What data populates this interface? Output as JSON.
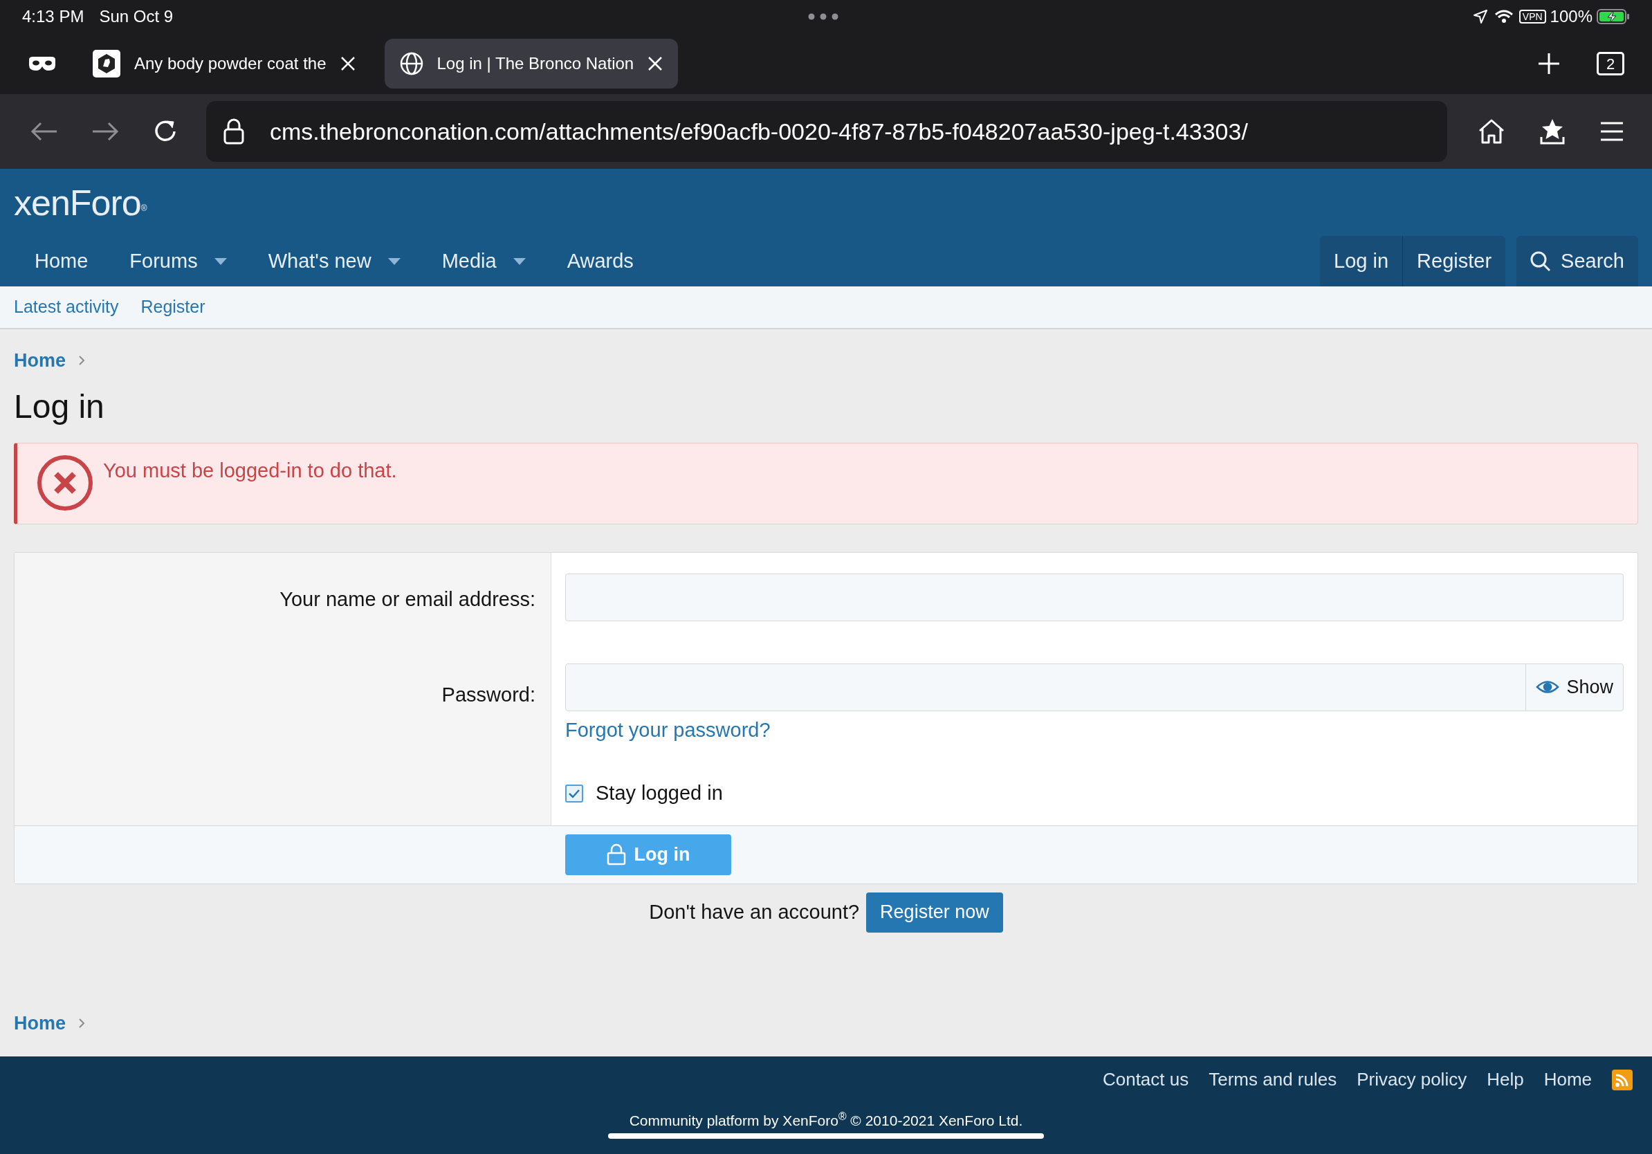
{
  "status_bar": {
    "time": "4:13 PM",
    "date": "Sun Oct 9",
    "vpn": "VPN",
    "battery": "100%"
  },
  "browser_tabs": [
    {
      "title": "Any body powder coat the",
      "kind": "favicon",
      "selected": false
    },
    {
      "title": "Log in | The Bronco Nation",
      "kind": "globe",
      "selected": true
    }
  ],
  "tab_count": "2",
  "address_bar": {
    "url": "cms.thebronconation.com/attachments/ef90acfb-0020-4f87-87b5-f048207aa530-jpeg-t.43303/"
  },
  "site": {
    "logo": "xenForo",
    "logo_mark": "®"
  },
  "nav": [
    {
      "label": "Home",
      "has_menu": false
    },
    {
      "label": "Forums",
      "has_menu": true
    },
    {
      "label": "What's new",
      "has_menu": true
    },
    {
      "label": "Media",
      "has_menu": true
    },
    {
      "label": "Awards",
      "has_menu": false
    }
  ],
  "account_links": [
    "Log in",
    "Register"
  ],
  "search_button": "Search",
  "sub_nav": [
    "Latest activity",
    "Register"
  ],
  "breadcrumb": "Home",
  "page_title": "Log in",
  "error": "You must be logged-in to do that.",
  "form": {
    "name_label": "Your name or email address:",
    "password_label": "Password:",
    "show_button": "Show",
    "forgot_link": "Forgot your password?",
    "stay_logged_in": {
      "label": "Stay logged in",
      "checked": true
    },
    "submit": "Log in"
  },
  "register_prompt": {
    "text": "Don't have an account?",
    "button": "Register now"
  },
  "bottom_breadcrumb": "Home",
  "footer": {
    "links": [
      "Contact us",
      "Terms and rules",
      "Privacy policy",
      "Help",
      "Home"
    ],
    "copyright": "Community platform by XenForo$^{®}$ © 2010-2021 XenForo Ltd."
  }
}
